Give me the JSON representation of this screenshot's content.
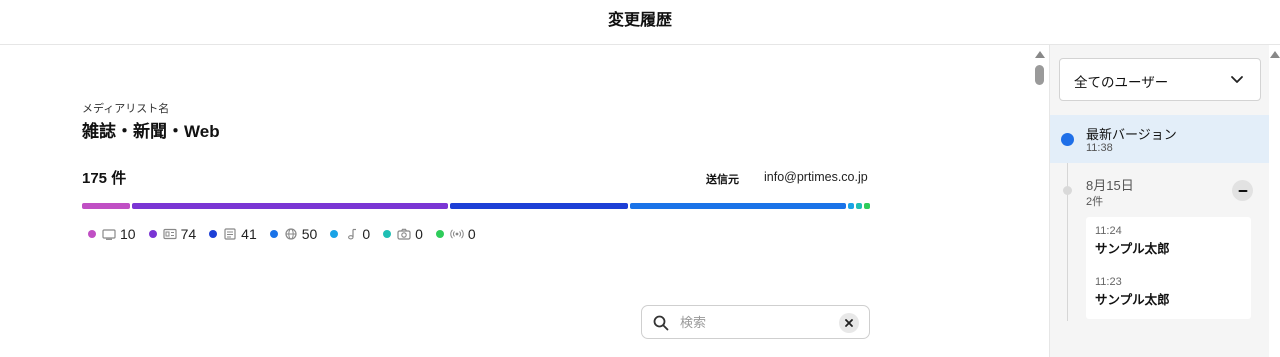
{
  "header": {
    "title": "変更履歴"
  },
  "media_list": {
    "label": "メディアリスト名",
    "name": "雑誌・新聞・Web",
    "count": "175 件",
    "sender_label": "送信元",
    "sender_email": "info@prtimes.co.jp"
  },
  "distribution": {
    "segments": [
      {
        "color": "#c04fc4",
        "value": 10
      },
      {
        "color": "#7a35d4",
        "value": 74
      },
      {
        "color": "#1d3fd6",
        "value": 41
      },
      {
        "color": "#1a73e8",
        "value": 50
      },
      {
        "color": "#1aa3e6",
        "value": 0
      },
      {
        "color": "#1fbfb4",
        "value": 0
      },
      {
        "color": "#2ecc5a",
        "value": 0
      }
    ],
    "legend": [
      {
        "icon": "tv-icon",
        "color": "#c04fc4",
        "value": "10"
      },
      {
        "icon": "magazine-icon",
        "color": "#7a35d4",
        "value": "74"
      },
      {
        "icon": "newspaper-icon",
        "color": "#1d3fd6",
        "value": "41"
      },
      {
        "icon": "globe-icon",
        "color": "#1a73e8",
        "value": "50"
      },
      {
        "icon": "music-note-icon",
        "color": "#1aa3e6",
        "value": "0"
      },
      {
        "icon": "camera-icon",
        "color": "#1fbfb4",
        "value": "0"
      },
      {
        "icon": "radio-icon",
        "color": "#2ecc5a",
        "value": "0"
      }
    ]
  },
  "search": {
    "placeholder": "検索",
    "value": ""
  },
  "sidebar": {
    "user_filter": "全てのユーザー",
    "latest": {
      "label": "最新バージョン",
      "time": "11:38"
    },
    "day": {
      "label": "8月15日",
      "count": "2件",
      "entries": [
        {
          "time": "11:24",
          "user": "サンプル太郎"
        },
        {
          "time": "11:23",
          "user": "サンプル太郎"
        }
      ]
    }
  }
}
